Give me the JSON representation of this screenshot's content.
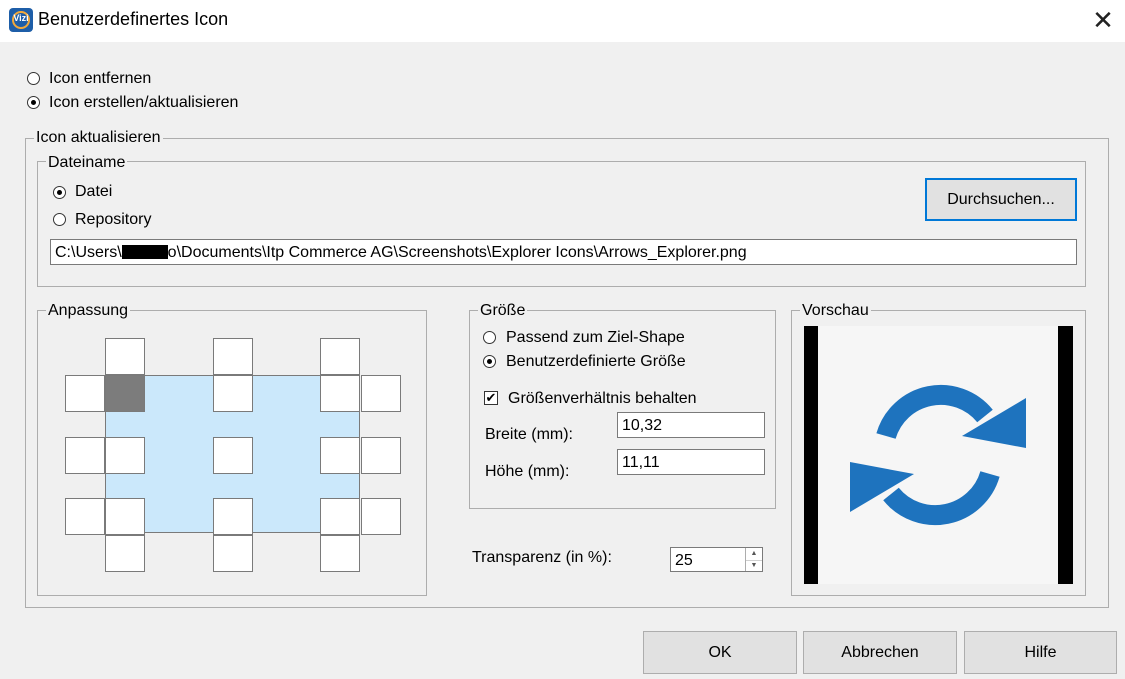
{
  "window": {
    "app_icon_text": "Vizi",
    "title": "Benutzerdefinertes Icon",
    "close_glyph": "✕"
  },
  "mode": {
    "remove_label": "Icon entfernen",
    "create_label": "Icon erstellen/aktualisieren",
    "selected": "create"
  },
  "update_group": {
    "legend": "Icon aktualisieren",
    "filename_group": {
      "legend": "Dateiname",
      "file_label": "Datei",
      "repository_label": "Repository",
      "selected": "file",
      "browse_label": "Durchsuchen...",
      "path_prefix": "C:\\Users\\",
      "path_suffix": "o\\Documents\\Itp Commerce AG\\Screenshots\\Explorer Icons\\Arrows_Explorer.png"
    },
    "adjust_group": {
      "legend": "Anpassung",
      "selected_anchor": "top-left"
    },
    "size_group": {
      "legend": "Größe",
      "fit_label": "Passend zum Ziel-Shape",
      "custom_label": "Benutzerdefinierte Größe",
      "selected": "custom",
      "keep_ratio_label": "Größenverhältnis behalten",
      "keep_ratio_checked": true,
      "check_glyph": "✔",
      "width_label": "Breite (mm):",
      "width_value": "10,32",
      "height_label": "Höhe (mm):",
      "height_value": "11,11"
    },
    "transparency": {
      "label": "Transparenz (in %):",
      "value": "25",
      "up_glyph": "▲",
      "down_glyph": "▼"
    },
    "preview_group": {
      "legend": "Vorschau",
      "icon": "refresh-arrows-icon",
      "icon_color": "#1e73be"
    }
  },
  "buttons": {
    "ok": "OK",
    "cancel": "Abbrechen",
    "help": "Hilfe"
  }
}
